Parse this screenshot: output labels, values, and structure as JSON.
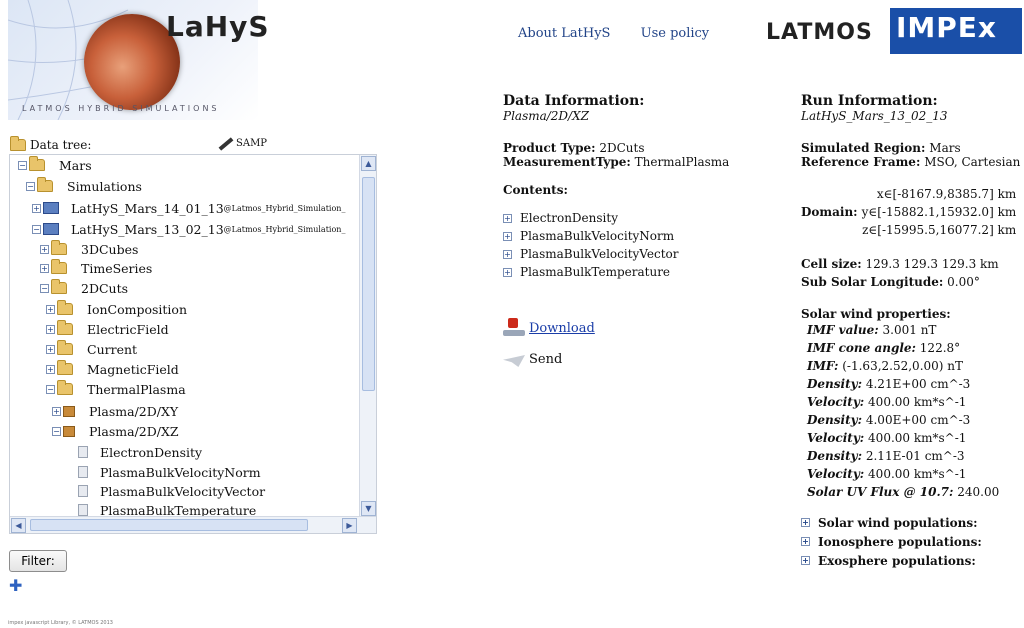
{
  "header": {
    "app_title": "LaHyS",
    "app_subtitle": "LATMOS HYBRID SIMULATIONS",
    "nav": [
      "About LatHyS",
      "Use policy"
    ],
    "partner_logos": [
      "LATMOS",
      "IMPEx"
    ]
  },
  "tree": {
    "header_label": "Data tree:",
    "samp_label": "SAMP",
    "rows": [
      {
        "label": "Mars"
      },
      {
        "label": "Simulations"
      },
      {
        "label": "LatHyS_Mars_14_01_13",
        "suffix": "@Latmos_Hybrid_Simulation_"
      },
      {
        "label": "LatHyS_Mars_13_02_13",
        "suffix": "@Latmos_Hybrid_Simulation_"
      },
      {
        "label": "3DCubes"
      },
      {
        "label": "TimeSeries"
      },
      {
        "label": "2DCuts"
      },
      {
        "label": "IonComposition"
      },
      {
        "label": "ElectricField"
      },
      {
        "label": "Current"
      },
      {
        "label": "MagneticField"
      },
      {
        "label": "ThermalPlasma"
      },
      {
        "label": "Plasma/2D/XY"
      },
      {
        "label": "Plasma/2D/XZ"
      },
      {
        "label": "ElectronDensity"
      },
      {
        "label": "PlasmaBulkVelocityNorm"
      },
      {
        "label": "PlasmaBulkVelocityVector"
      },
      {
        "label": "PlasmaBulkTemperature"
      }
    ],
    "filter_label": "Filter:"
  },
  "data_info": {
    "title": "Data Information:",
    "path": "Plasma/2D/XZ",
    "product_type_label": "Product Type:",
    "product_type": "2DCuts",
    "measurement_type_label": "MeasurementType:",
    "measurement_type": "ThermalPlasma",
    "contents_label": "Contents:",
    "contents": [
      "ElectronDensity",
      "PlasmaBulkVelocityNorm",
      "PlasmaBulkVelocityVector",
      "PlasmaBulkTemperature"
    ],
    "download_label": "Download",
    "send_label": "Send"
  },
  "run_info": {
    "title": "Run Information:",
    "run_name": "LatHyS_Mars_13_02_13",
    "region_label": "Simulated Region:",
    "region": "Mars",
    "frame_label": "Reference Frame:",
    "frame": "MSO, Cartesian",
    "domain_label": "Domain:",
    "domain": [
      "x∈[-8167.9,8385.7] km",
      "y∈[-15882.1,15932.0] km",
      "z∈[-15995.5,16077.2] km"
    ],
    "cell_size_label": "Cell size:",
    "cell_size": "129.3 129.3 129.3 km",
    "subsolar_label": "Sub Solar Longitude:",
    "subsolar": "0.00°",
    "solar_wind_label": "Solar wind properties:",
    "solar_wind": [
      {
        "label": "IMF value:",
        "value": "3.001 nT"
      },
      {
        "label": "IMF cone angle:",
        "value": "122.8°"
      },
      {
        "label": "IMF:",
        "value": "(-1.63,2.52,0.00) nT"
      },
      {
        "label": "Density:",
        "value": "4.21E+00 cm^-3"
      },
      {
        "label": "Velocity:",
        "value": "400.00 km*s^-1"
      },
      {
        "label": "Density:",
        "value": "4.00E+00 cm^-3"
      },
      {
        "label": "Velocity:",
        "value": "400.00 km*s^-1"
      },
      {
        "label": "Density:",
        "value": "2.11E-01 cm^-3"
      },
      {
        "label": "Velocity:",
        "value": "400.00 km*s^-1"
      },
      {
        "label": "Solar UV Flux @ 10.7:",
        "value": "240.00"
      }
    ],
    "populations": [
      "Solar wind populations:",
      "Ionosphere populations:",
      "Exosphere populations:"
    ]
  },
  "footer": "impex javascript Library, © LATMOS 2013"
}
